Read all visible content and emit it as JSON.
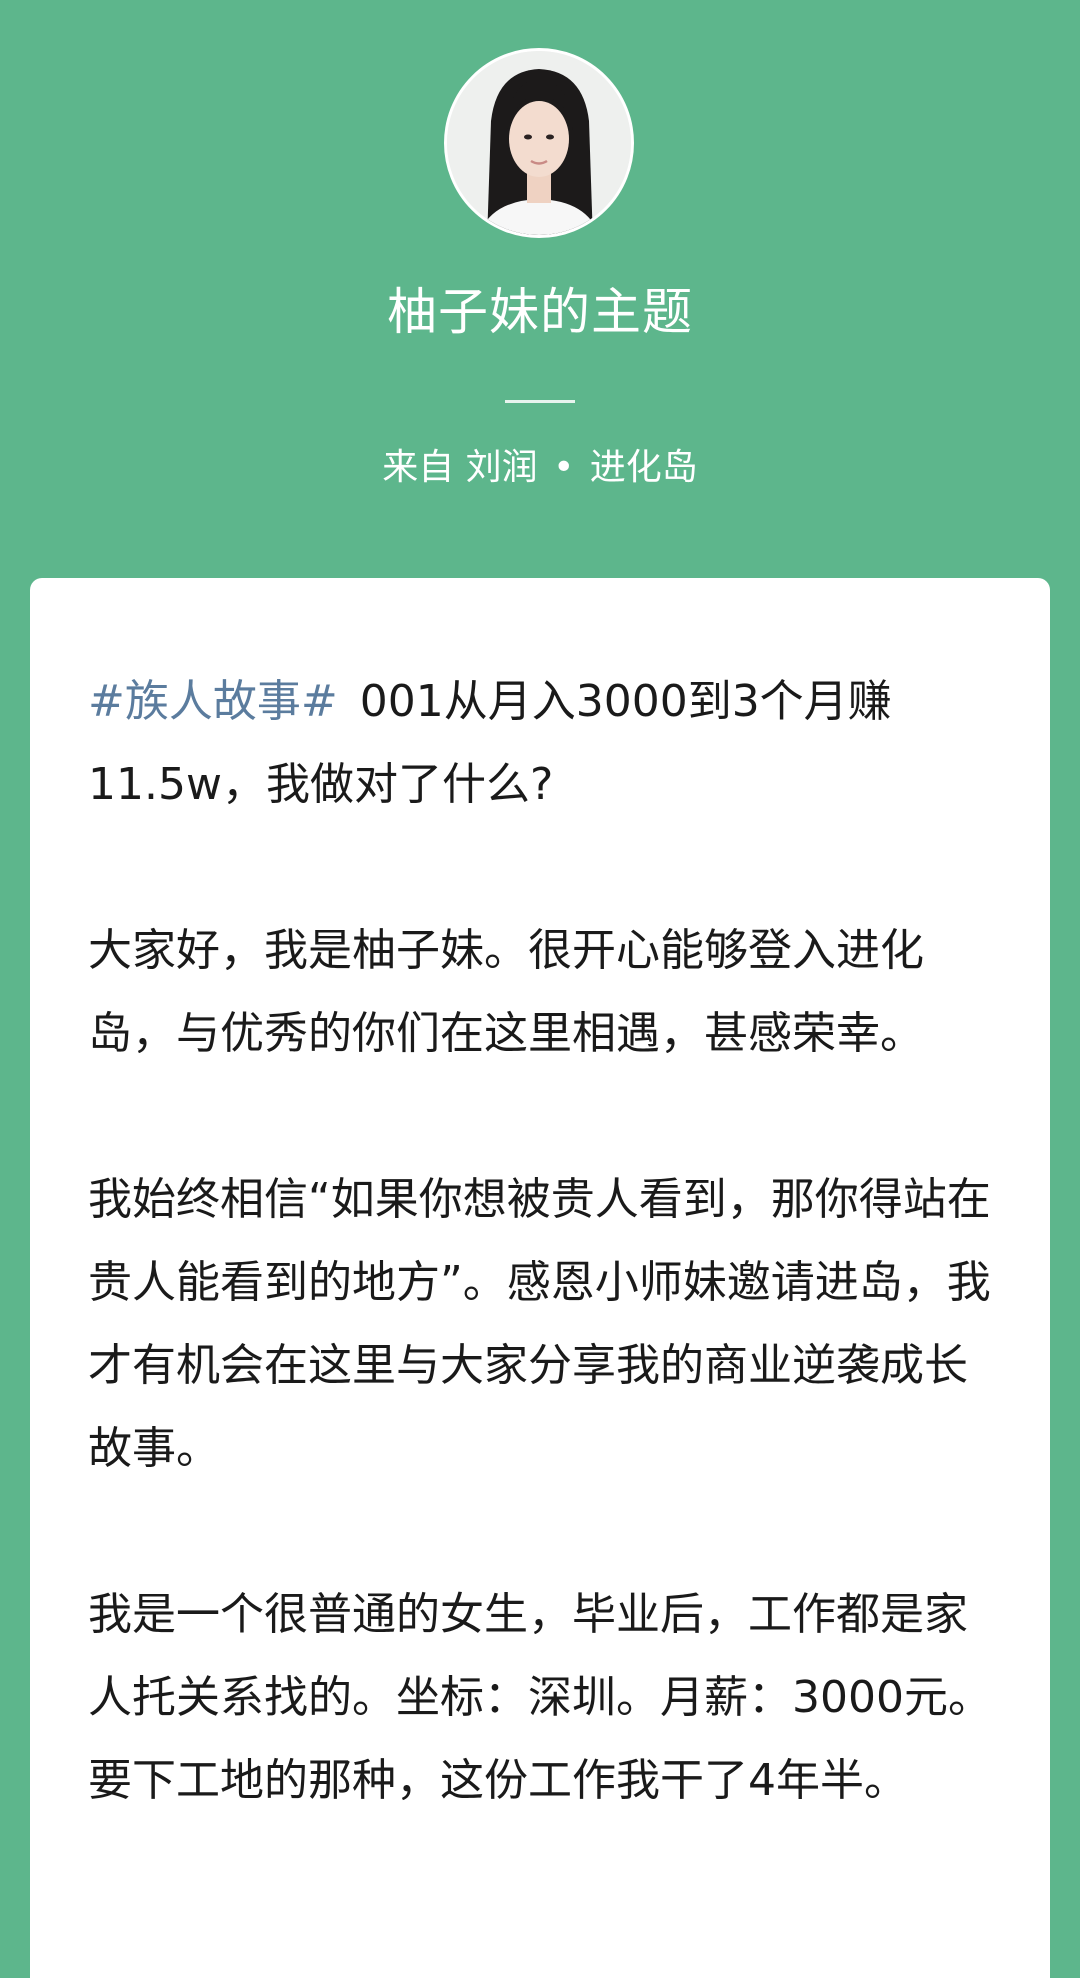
{
  "header": {
    "avatar_alt": "avatar",
    "title": "柚子妹的主题",
    "source_prefix": "来自 刘润",
    "source_dot": "•",
    "source_group": "进化岛"
  },
  "post": {
    "hashtag": "#族人故事#",
    "title_text": "001从月入3000到3个月赚11.5w，我做对了什么?",
    "paragraphs": [
      "大家好，我是柚子妹。很开心能够登入进化岛，与优秀的你们在这里相遇，甚感荣幸。",
      "我始终相信“如果你想被贵人看到，那你得站在贵人能看到的地方”。感恩小师妹邀请进岛，我才有机会在这里与大家分享我的商业逆袭成长故事。",
      "我是一个很普通的女生，毕业后，工作都是家人托关系找的。坐标：深圳。月薪：3000元。要下工地的那种，这份工作我干了4年半。"
    ]
  },
  "colors": {
    "background": "#5db68c",
    "card": "#ffffff",
    "hashtag": "#5b7c9e",
    "text": "#1a1a1a"
  }
}
